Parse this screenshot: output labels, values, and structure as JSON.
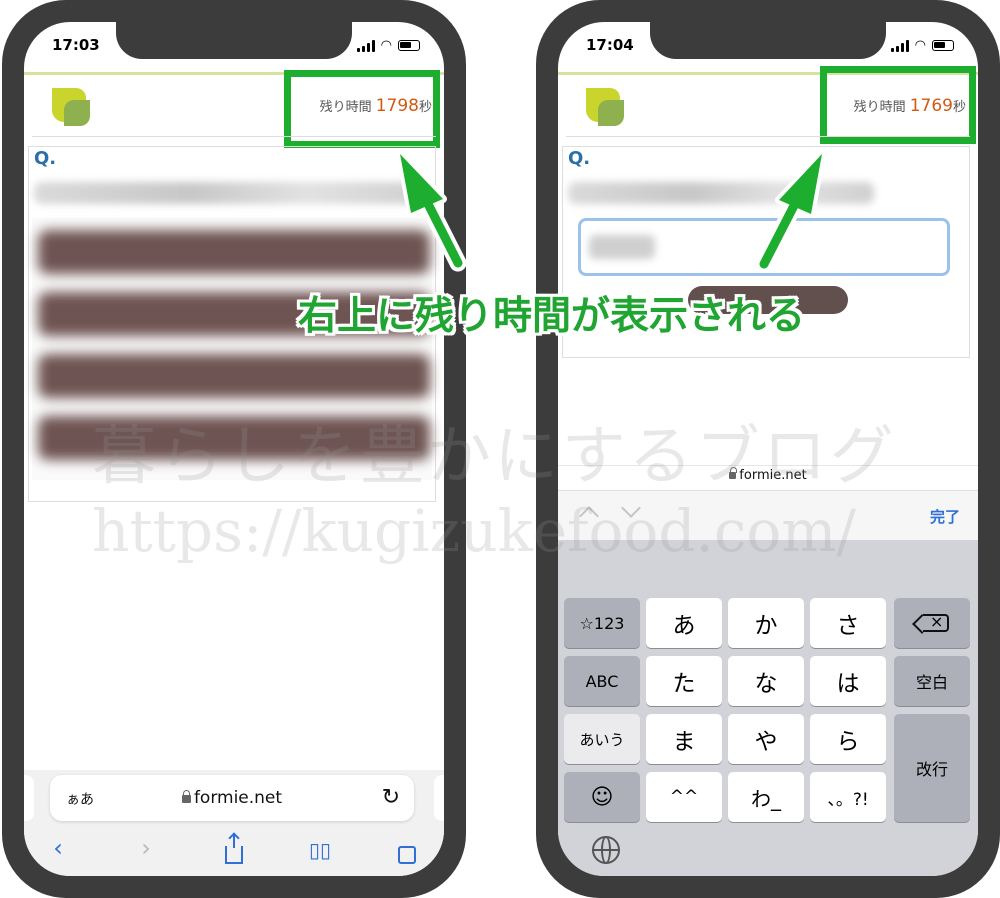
{
  "left_phone": {
    "status_time": "17:03",
    "timer": {
      "label": "残り時間",
      "value": "1798",
      "unit": "秒"
    },
    "question_mark": "Q.",
    "url_bar": {
      "aa": "ぁあ",
      "domain": "formie.net"
    }
  },
  "right_phone": {
    "status_time": "17:04",
    "timer": {
      "label": "残り時間",
      "value": "1769",
      "unit": "秒"
    },
    "question_mark": "Q.",
    "url_line": "formie.net",
    "accessory": {
      "done": "完了"
    },
    "keyboard": {
      "rows": [
        [
          "☆123",
          "あ",
          "か",
          "さ",
          ""
        ],
        [
          "ABC",
          "た",
          "な",
          "は",
          "空白"
        ],
        [
          "あいう",
          "ま",
          "や",
          "ら",
          "改行"
        ],
        [
          "",
          "^^",
          "わ_",
          "、。?!"
        ]
      ]
    }
  },
  "callout": "右上に残り時間が表示される",
  "watermark": {
    "line1": "暮らしを豊かにするブログ",
    "line2": "https://kugizukefood.com/"
  },
  "colors": {
    "highlight": "#1eae2f",
    "timer_value": "#d25a12",
    "link_blue": "#2f6fd6",
    "phone_frame": "#3c3c3c"
  }
}
